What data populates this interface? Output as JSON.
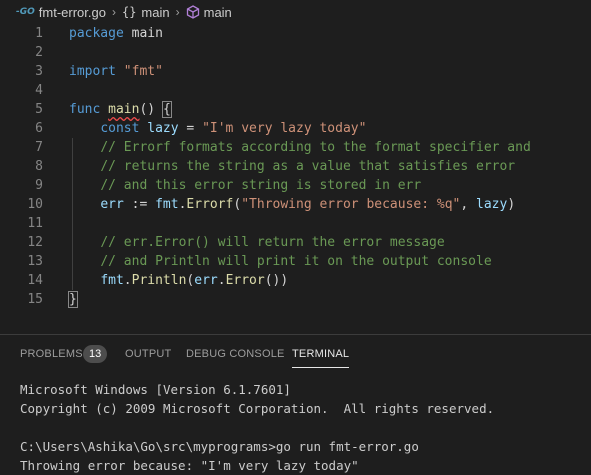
{
  "breadcrumb": {
    "file": "fmt-error.go",
    "items": [
      "main",
      "main"
    ]
  },
  "editor": {
    "lines": [
      {
        "n": "1",
        "tokens": [
          [
            "kw",
            "package"
          ],
          [
            "plain",
            " main"
          ]
        ]
      },
      {
        "n": "2",
        "tokens": []
      },
      {
        "n": "3",
        "tokens": [
          [
            "kw",
            "import"
          ],
          [
            "plain",
            " "
          ],
          [
            "str",
            "\"fmt\""
          ]
        ]
      },
      {
        "n": "4",
        "tokens": []
      },
      {
        "n": "5",
        "tokens": [
          [
            "kw",
            "func"
          ],
          [
            "plain",
            " "
          ],
          [
            "fn_sq",
            "main"
          ],
          [
            "plain",
            "() "
          ],
          [
            "brace",
            "{"
          ]
        ]
      },
      {
        "n": "6",
        "tokens": [
          [
            "plain",
            "    "
          ],
          [
            "kw",
            "const"
          ],
          [
            "plain",
            " "
          ],
          [
            "var",
            "lazy"
          ],
          [
            "plain",
            " = "
          ],
          [
            "str",
            "\"I'm very lazy today\""
          ]
        ]
      },
      {
        "n": "7",
        "tokens": [
          [
            "plain",
            "    "
          ],
          [
            "cm",
            "// Errorf formats according to the format specifier and"
          ]
        ]
      },
      {
        "n": "8",
        "tokens": [
          [
            "plain",
            "    "
          ],
          [
            "cm",
            "// returns the string as a value that satisfies error"
          ]
        ]
      },
      {
        "n": "9",
        "tokens": [
          [
            "plain",
            "    "
          ],
          [
            "cm",
            "// and this error string is stored in err"
          ]
        ]
      },
      {
        "n": "10",
        "tokens": [
          [
            "plain",
            "    "
          ],
          [
            "var",
            "err"
          ],
          [
            "plain",
            " := "
          ],
          [
            "var",
            "fmt"
          ],
          [
            "plain",
            "."
          ],
          [
            "fn",
            "Errorf"
          ],
          [
            "plain",
            "("
          ],
          [
            "str",
            "\"Throwing error because: %q\""
          ],
          [
            "plain",
            ", "
          ],
          [
            "var",
            "lazy"
          ],
          [
            "plain",
            ")"
          ]
        ]
      },
      {
        "n": "11",
        "tokens": []
      },
      {
        "n": "12",
        "tokens": [
          [
            "plain",
            "    "
          ],
          [
            "cm",
            "// err.Error() will return the error message"
          ]
        ]
      },
      {
        "n": "13",
        "tokens": [
          [
            "plain",
            "    "
          ],
          [
            "cm",
            "// and Println will print it on the output console"
          ]
        ]
      },
      {
        "n": "14",
        "tokens": [
          [
            "plain",
            "    "
          ],
          [
            "var",
            "fmt"
          ],
          [
            "plain",
            "."
          ],
          [
            "fn",
            "Println"
          ],
          [
            "plain",
            "("
          ],
          [
            "var",
            "err"
          ],
          [
            "plain",
            "."
          ],
          [
            "fn",
            "Error"
          ],
          [
            "plain",
            "())"
          ]
        ]
      },
      {
        "n": "15",
        "tokens": [
          [
            "brace",
            "}"
          ]
        ]
      }
    ]
  },
  "panel": {
    "tabs": [
      {
        "label": "PROBLEMS",
        "active": false
      },
      {
        "label": "OUTPUT",
        "active": false
      },
      {
        "label": "DEBUG CONSOLE",
        "active": false
      },
      {
        "label": "TERMINAL",
        "active": true
      }
    ],
    "problems_count": "13"
  },
  "terminal": {
    "lines": [
      "Microsoft Windows [Version 6.1.7601]",
      "Copyright (c) 2009 Microsoft Corporation.  All rights reserved.",
      "",
      "C:\\Users\\Ashika\\Go\\src\\myprograms>go run fmt-error.go",
      "Throwing error because: \"I'm very lazy today\""
    ]
  },
  "colors": {
    "keyword": "#569cd6",
    "function": "#dcdcaa",
    "string": "#ce9178",
    "variable": "#9cdcfe",
    "comment": "#6a9955",
    "background": "#1e1e1e"
  }
}
